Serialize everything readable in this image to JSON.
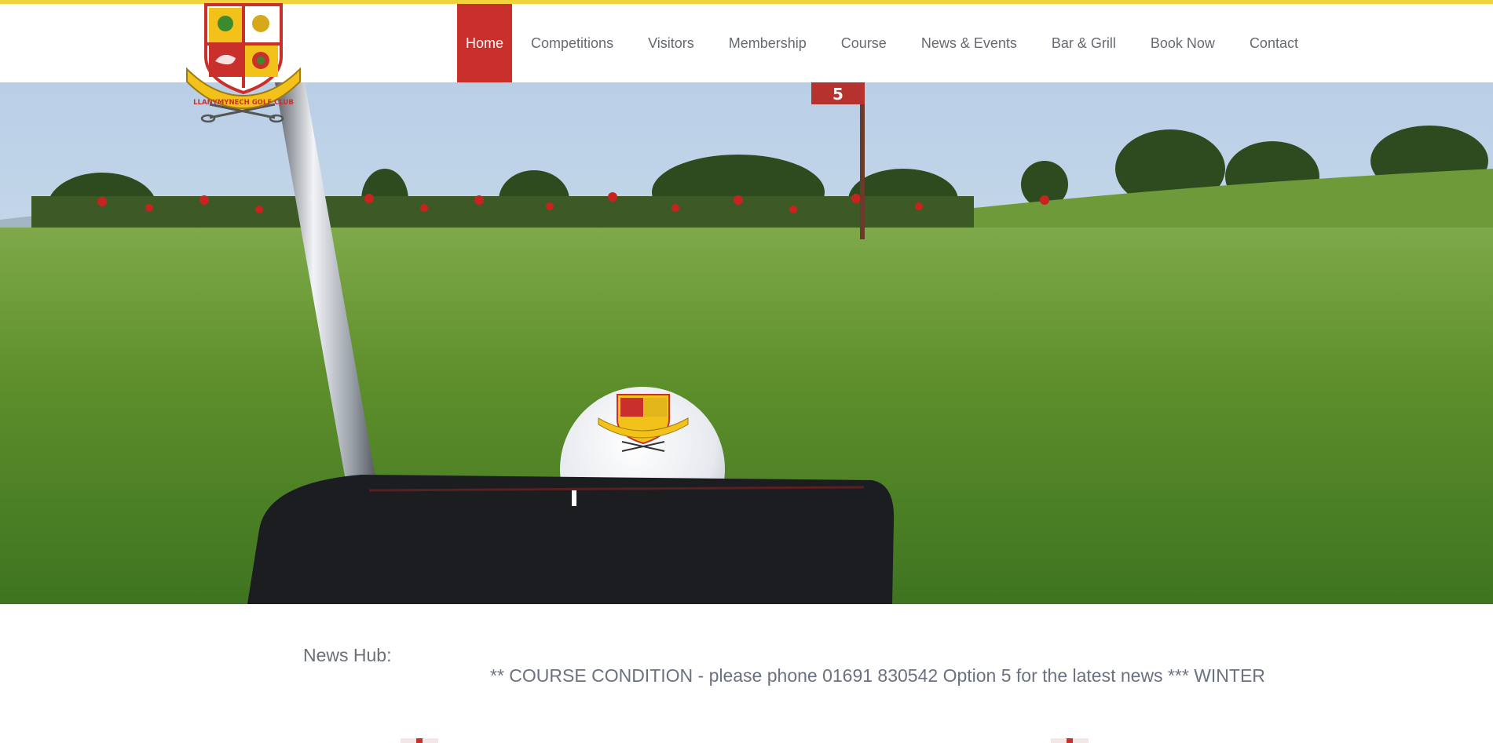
{
  "brand": {
    "name": "LLANYMYNECH GOLF CLUB",
    "colors": {
      "accent_yellow": "#f2d33b",
      "active_red": "#c9302c",
      "crest_red": "#c9302c",
      "crest_gold": "#f2c21a"
    }
  },
  "nav": {
    "items": [
      {
        "label": "Home",
        "active": true
      },
      {
        "label": "Competitions"
      },
      {
        "label": "Visitors"
      },
      {
        "label": "Membership"
      },
      {
        "label": "Course"
      },
      {
        "label": "News & Events"
      },
      {
        "label": "Bar & Grill"
      },
      {
        "label": "Book Now"
      },
      {
        "label": "Contact"
      }
    ]
  },
  "hero": {
    "flag_number": "5"
  },
  "news": {
    "label": "News Hub:",
    "ticker": "** COURSE CONDITION - please phone 01691 830542 Option 5 for the latest news *** WINTER DEAL: "
  }
}
